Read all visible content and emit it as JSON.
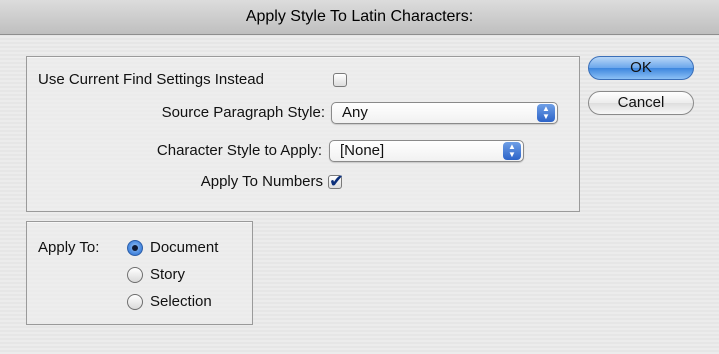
{
  "window": {
    "title": "Apply Style To Latin Characters:"
  },
  "find_panel": {
    "use_current_find_label": "Use Current Find Settings Instead",
    "use_current_find_checked": false,
    "source_paragraph_label": "Source Paragraph Style:",
    "source_paragraph_value": "Any",
    "character_style_label": "Character Style to Apply:",
    "character_style_value": "[None]",
    "apply_numbers_label": "Apply To Numbers",
    "apply_numbers_checked": true
  },
  "buttons": {
    "ok": "OK",
    "cancel": "Cancel"
  },
  "apply_to": {
    "label": "Apply To:",
    "options": [
      {
        "label": "Document",
        "selected": true
      },
      {
        "label": "Story",
        "selected": false
      },
      {
        "label": "Selection",
        "selected": false
      }
    ]
  },
  "colors": {
    "accent_blue": "#3d86de",
    "check_mark": "#0b2f7a"
  }
}
